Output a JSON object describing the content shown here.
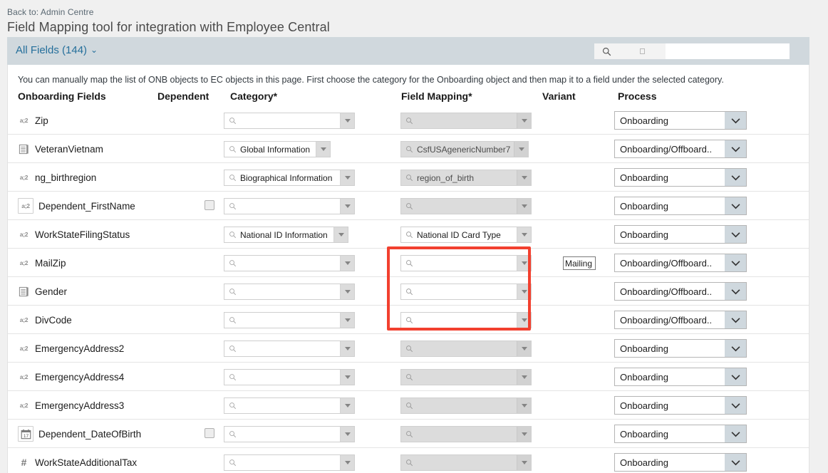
{
  "breadcrumb": "Back to: Admin Centre",
  "page_title": "Field Mapping tool for integration with Employee Central",
  "toolbar": {
    "all_fields_label": "All Fields (144)",
    "chevron": "⌄",
    "search_icon": "search-icon",
    "search_value": "",
    "search_placeholder": ""
  },
  "intro_text": "You can manually map the list of ONB objects to EC objects in this page. First choose the category for the Onboarding object and then map it to a field under the selected category.",
  "columns": {
    "onboarding_fields": "Onboarding Fields",
    "dependent": "Dependent",
    "category": "Category*",
    "field_mapping": "Field Mapping*",
    "variant": "Variant",
    "process": "Process"
  },
  "colors": {
    "accent_blue": "#256f9b",
    "toolbar_bg": "#d0d8dd",
    "plus_green": "#5aac1e",
    "annotation_red": "#f2402f",
    "disabled_grey": "#dcdcdc"
  },
  "annotation": {
    "type": "red-highlight-box",
    "covers": "field-mapping dropdowns for MailZip, Gender, DivCode"
  },
  "rows": [
    {
      "field": "Zip",
      "icon": "string-type-icon",
      "icon_glyph": "a;2",
      "boxed_icon": false,
      "dependent": false,
      "category": "",
      "category_disabled": false,
      "category_width": 184,
      "mapping": "",
      "mapping_disabled": true,
      "mapping_width": 184,
      "mapping_plus": false,
      "variant": "",
      "process": "Onboarding"
    },
    {
      "field": "VeteranVietnam",
      "icon": "picklist-type-icon",
      "icon_glyph": "",
      "boxed_icon": false,
      "dependent": false,
      "category": "Global Information",
      "category_disabled": false,
      "category_width": 150,
      "mapping": "CsfUSAgenericNumber7",
      "mapping_disabled": true,
      "mapping_width": 180,
      "mapping_plus": true,
      "variant": "",
      "process": "Onboarding/Offboard.."
    },
    {
      "field": "ng_birthregion",
      "icon": "string-type-icon",
      "icon_glyph": "a;2",
      "boxed_icon": false,
      "dependent": false,
      "category": "Biographical Information",
      "category_disabled": false,
      "category_width": 184,
      "mapping": "region_of_birth",
      "mapping_disabled": true,
      "mapping_width": 184,
      "mapping_plus": false,
      "variant": "",
      "process": "Onboarding"
    },
    {
      "field": "Dependent_FirstName",
      "icon": "dependent-string-type-icon",
      "icon_glyph": "a;2",
      "boxed_icon": true,
      "dependent": true,
      "category": "",
      "category_disabled": false,
      "category_width": 184,
      "mapping": "",
      "mapping_disabled": true,
      "mapping_width": 184,
      "mapping_plus": false,
      "variant": "",
      "process": "Onboarding"
    },
    {
      "field": "WorkStateFilingStatus",
      "icon": "string-type-icon",
      "icon_glyph": "a;2",
      "boxed_icon": false,
      "dependent": false,
      "category": "National ID Information",
      "category_disabled": false,
      "category_width": 175,
      "mapping": "National ID Card Type",
      "mapping_disabled": false,
      "mapping_width": 184,
      "mapping_plus": false,
      "variant": "",
      "process": "Onboarding"
    },
    {
      "field": "MailZip",
      "icon": "string-type-icon",
      "icon_glyph": "a;2",
      "boxed_icon": false,
      "dependent": false,
      "category": "",
      "category_disabled": false,
      "category_width": 184,
      "mapping": "",
      "mapping_disabled": false,
      "mapping_width": 184,
      "mapping_plus": false,
      "variant": "Mailing",
      "process": "Onboarding/Offboard.."
    },
    {
      "field": "Gender",
      "icon": "picklist-type-icon",
      "icon_glyph": "",
      "boxed_icon": false,
      "dependent": false,
      "category": "",
      "category_disabled": false,
      "category_width": 184,
      "mapping": "",
      "mapping_disabled": false,
      "mapping_width": 184,
      "mapping_plus": false,
      "variant": "",
      "process": "Onboarding/Offboard.."
    },
    {
      "field": "DivCode",
      "icon": "string-type-icon",
      "icon_glyph": "a;2",
      "boxed_icon": false,
      "dependent": false,
      "category": "",
      "category_disabled": false,
      "category_width": 184,
      "mapping": "",
      "mapping_disabled": false,
      "mapping_width": 184,
      "mapping_plus": false,
      "variant": "",
      "process": "Onboarding/Offboard.."
    },
    {
      "field": "EmergencyAddress2",
      "icon": "string-type-icon",
      "icon_glyph": "a;2",
      "boxed_icon": false,
      "dependent": false,
      "category": "",
      "category_disabled": false,
      "category_width": 184,
      "mapping": "",
      "mapping_disabled": true,
      "mapping_width": 184,
      "mapping_plus": false,
      "variant": "",
      "process": "Onboarding"
    },
    {
      "field": "EmergencyAddress4",
      "icon": "string-type-icon",
      "icon_glyph": "a;2",
      "boxed_icon": false,
      "dependent": false,
      "category": "",
      "category_disabled": false,
      "category_width": 184,
      "mapping": "",
      "mapping_disabled": true,
      "mapping_width": 184,
      "mapping_plus": false,
      "variant": "",
      "process": "Onboarding"
    },
    {
      "field": "EmergencyAddress3",
      "icon": "string-type-icon",
      "icon_glyph": "a;2",
      "boxed_icon": false,
      "dependent": false,
      "category": "",
      "category_disabled": false,
      "category_width": 184,
      "mapping": "",
      "mapping_disabled": true,
      "mapping_width": 184,
      "mapping_plus": false,
      "variant": "",
      "process": "Onboarding"
    },
    {
      "field": "Dependent_DateOfBirth",
      "icon": "date-type-icon",
      "icon_glyph": "17",
      "boxed_icon": true,
      "dependent": true,
      "category": "",
      "category_disabled": false,
      "category_width": 184,
      "mapping": "",
      "mapping_disabled": true,
      "mapping_width": 184,
      "mapping_plus": false,
      "variant": "",
      "process": "Onboarding"
    },
    {
      "field": "WorkStateAdditionalTax",
      "icon": "number-type-icon",
      "icon_glyph": "#",
      "boxed_icon": false,
      "dependent": false,
      "category": "",
      "category_disabled": false,
      "category_width": 184,
      "mapping": "",
      "mapping_disabled": true,
      "mapping_width": 184,
      "mapping_plus": false,
      "variant": "",
      "process": "Onboarding"
    }
  ]
}
